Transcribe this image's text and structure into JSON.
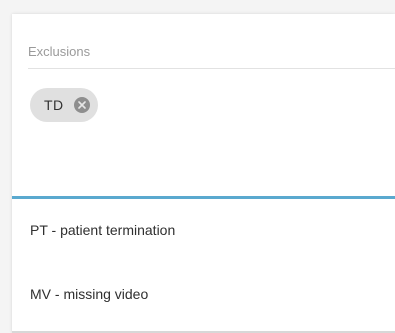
{
  "field": {
    "label": "Exclusions",
    "selected_chips": [
      {
        "label": "TD",
        "remove_icon": "close-circle-icon"
      }
    ]
  },
  "dropdown": {
    "options": [
      {
        "label": "PT - patient termination"
      },
      {
        "label": "MV - missing video"
      }
    ]
  },
  "colors": {
    "focus_accent": "#5aa9cf",
    "chip_background": "#e0e0e0"
  }
}
